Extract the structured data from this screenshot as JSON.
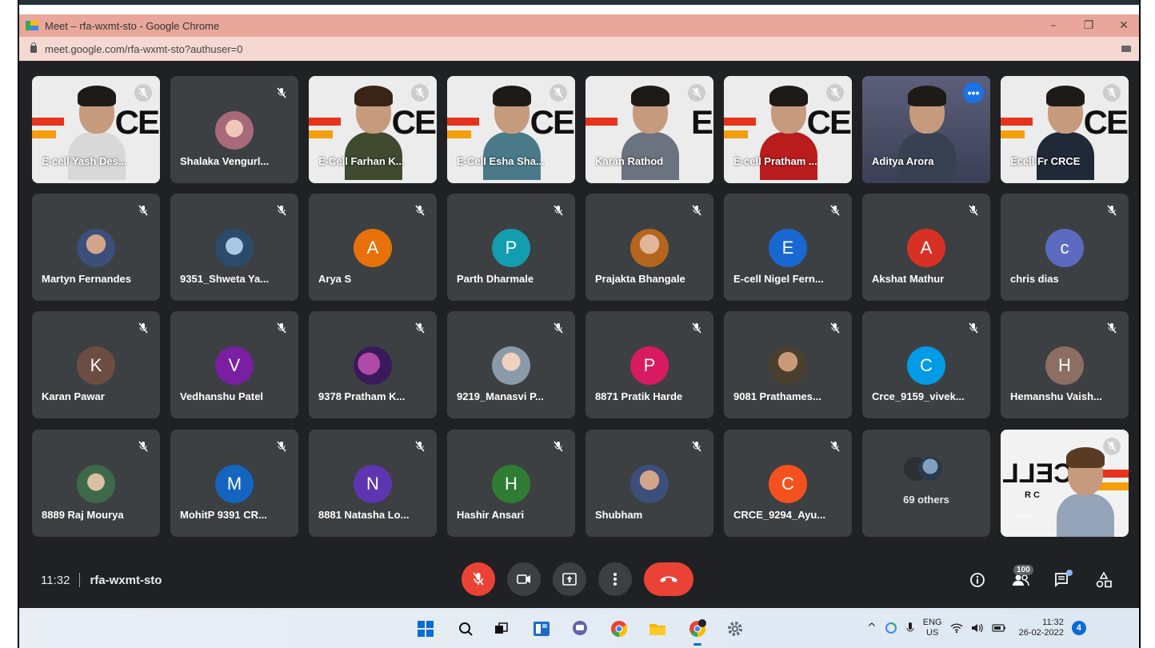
{
  "browser": {
    "window_title": "Meet – rfa-wxmt-sto - Google Chrome",
    "url": "meet.google.com/rfa-wxmt-sto?authuser=0",
    "controls": [
      "–",
      "❐",
      "✕"
    ]
  },
  "video_tiles": [
    {
      "name": "E-cell Yash Des...",
      "brand_letters": "CE"
    },
    {
      "name": "Shalaka Vengurl...",
      "avatar_type": "photo"
    },
    {
      "name": "E-Cell Farhan K...",
      "brand_letters": "CE"
    },
    {
      "name": "E-Cell Esha Sha...",
      "brand_letters": "CE"
    },
    {
      "name": "Karan Rathod",
      "brand_letters": "E"
    },
    {
      "name": "E-cell Pratham ...",
      "brand_letters": "CE"
    },
    {
      "name": "Aditya Arora",
      "active_speaker": true
    },
    {
      "name": "Ecell Fr CRCE",
      "brand_letters": "CE"
    }
  ],
  "participants_row2": [
    {
      "name": "Martyn Fernandes",
      "initial": "",
      "color": "photo"
    },
    {
      "name": "9351_Shweta Ya...",
      "initial": "",
      "color": "photo"
    },
    {
      "name": "Arya S",
      "initial": "A",
      "color": "#e8710a"
    },
    {
      "name": "Parth Dharmale",
      "initial": "P",
      "color": "#129eaf"
    },
    {
      "name": "Prajakta Bhangale",
      "initial": "",
      "color": "photo"
    },
    {
      "name": "E-cell Nigel Fern...",
      "initial": "E",
      "color": "#1967d2"
    },
    {
      "name": "Akshat Mathur",
      "initial": "A",
      "color": "#d93025"
    },
    {
      "name": "chris dias",
      "initial": "c",
      "color": "#5c6bc0"
    }
  ],
  "participants_row3": [
    {
      "name": "Karan Pawar",
      "initial": "K",
      "color": "#6d4c41"
    },
    {
      "name": "Vedhanshu Patel",
      "initial": "V",
      "color": "#7b1fa2"
    },
    {
      "name": "9378 Pratham K...",
      "initial": "",
      "color": "photo"
    },
    {
      "name": "9219_Manasvi P...",
      "initial": "",
      "color": "photo"
    },
    {
      "name": "8871 Pratik Harde",
      "initial": "P",
      "color": "#d81b60"
    },
    {
      "name": "9081 Prathames...",
      "initial": "",
      "color": "photo"
    },
    {
      "name": "Crce_9159_vivek...",
      "initial": "C",
      "color": "#039be5"
    },
    {
      "name": "Hemanshu Vaish...",
      "initial": "H",
      "color": "#8d6e63"
    }
  ],
  "participants_row4": [
    {
      "name": "8889 Raj Mourya",
      "initial": "",
      "color": "photo"
    },
    {
      "name": "MohitP 9391 CR...",
      "initial": "M",
      "color": "#1565c0"
    },
    {
      "name": "8881 Natasha Lo...",
      "initial": "N",
      "color": "#5e35b1"
    },
    {
      "name": "Hashir Ansari",
      "initial": "H",
      "color": "#2e7d32"
    },
    {
      "name": "Shubham",
      "initial": "",
      "color": "photo"
    },
    {
      "name": "CRCE_9294_Ayu...",
      "initial": "C",
      "color": "#f4511e"
    }
  ],
  "others": {
    "label": "69 others"
  },
  "self_view": {
    "brand_letters": "CELL",
    "brand_small": "R   C",
    "you": "You"
  },
  "meeting": {
    "time": "11:32",
    "code": "rfa-wxmt-sto",
    "participant_count": "100"
  },
  "controls": {
    "mic": "mic-off-icon",
    "camera": "camera-icon",
    "present": "present-icon",
    "more": "more-vert-icon",
    "end_call": "end-call-icon"
  },
  "taskbar": {
    "lang_top": "ENG",
    "lang_bottom": "US",
    "clock_time": "11:32",
    "clock_date": "26-02-2022",
    "notification_count": "4"
  },
  "colors": {
    "meet_bg": "#202124",
    "tile_bg": "#3c4043",
    "end_red": "#ea4335",
    "active_blue": "#8ab4f8",
    "titlebar": "#e8a79a"
  }
}
